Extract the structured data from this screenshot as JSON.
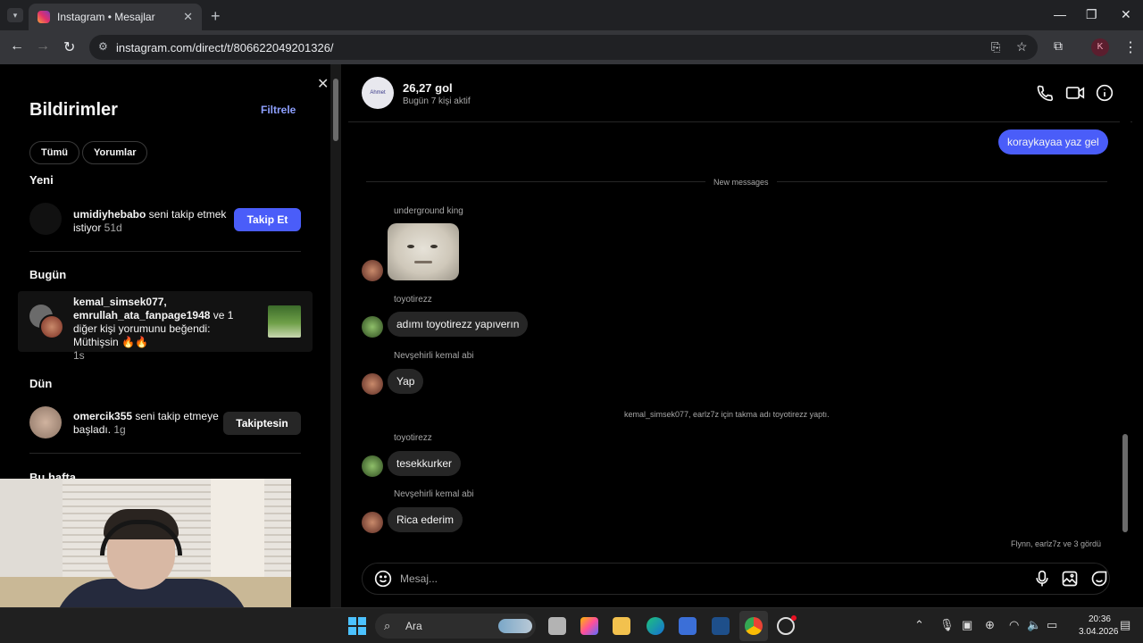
{
  "browser": {
    "tab_title": "Instagram • Mesajlar",
    "url": "instagram.com/direct/t/806622049201326/",
    "profile_initial": "K"
  },
  "notifications": {
    "title": "Bildirimler",
    "filter_label": "Filtrele",
    "pills": [
      "Tümü",
      "Yorumlar"
    ],
    "sections": {
      "new": "Yeni",
      "today": "Bugün",
      "yesterday": "Dün",
      "this_week": "Bu hafta"
    },
    "items": [
      {
        "user": "umidiyhebabo",
        "text": " seni takip etmek istiyor",
        "time": " 51d",
        "action": "Takip Et"
      },
      {
        "user": "kemal_simsek077,",
        "user2": "emrullah_ata_fanpage1948",
        "text": " ve 1 diğer kişi yorumunu beğendi: Müthişsin 🔥🔥",
        "time": "1s"
      },
      {
        "user": "omercik355",
        "text": " seni takip etmeye başladı.",
        "time": " 1g",
        "action": "Takiptesin"
      }
    ]
  },
  "chat": {
    "group_name": "26,27 gol",
    "group_status": "Bugün 7 kişi aktif",
    "group_avatar_text": "Ahmet MUAM Damir Yeşiağ Kitaplığı",
    "messages": {
      "my_message": "koraykayaa yaz gel",
      "new_messages_label": "New messages",
      "sender1": "underground king",
      "sender2": "toyotirezz",
      "msg2": "adımı toyotirezz yapıverın",
      "sender3": "Nevşehirli kemal abi",
      "msg3": "Yap",
      "system": "kemal_simsek077, earlz7z için takma adı toyotirezz yaptı.",
      "sender4": "toyotirezz",
      "msg4": "tesekkurker",
      "sender5": "Nevşehirli kemal abi",
      "msg5": "Rica ederim",
      "seen": "Flynn, earlz7z ve 3 gördü"
    },
    "composer_placeholder": "Mesaj..."
  },
  "taskbar": {
    "search_placeholder": "Ara",
    "time": "20:36",
    "date": "3.04.2026"
  },
  "icons": {
    "phone": "phone-icon",
    "video": "video-icon",
    "info": "info-icon",
    "emoji": "emoji-icon",
    "mic": "microphone-icon",
    "image": "image-icon",
    "sticker": "sticker-icon"
  },
  "colors": {
    "accent": "#4a5df9",
    "bubble": "#262626",
    "background": "#000000"
  }
}
